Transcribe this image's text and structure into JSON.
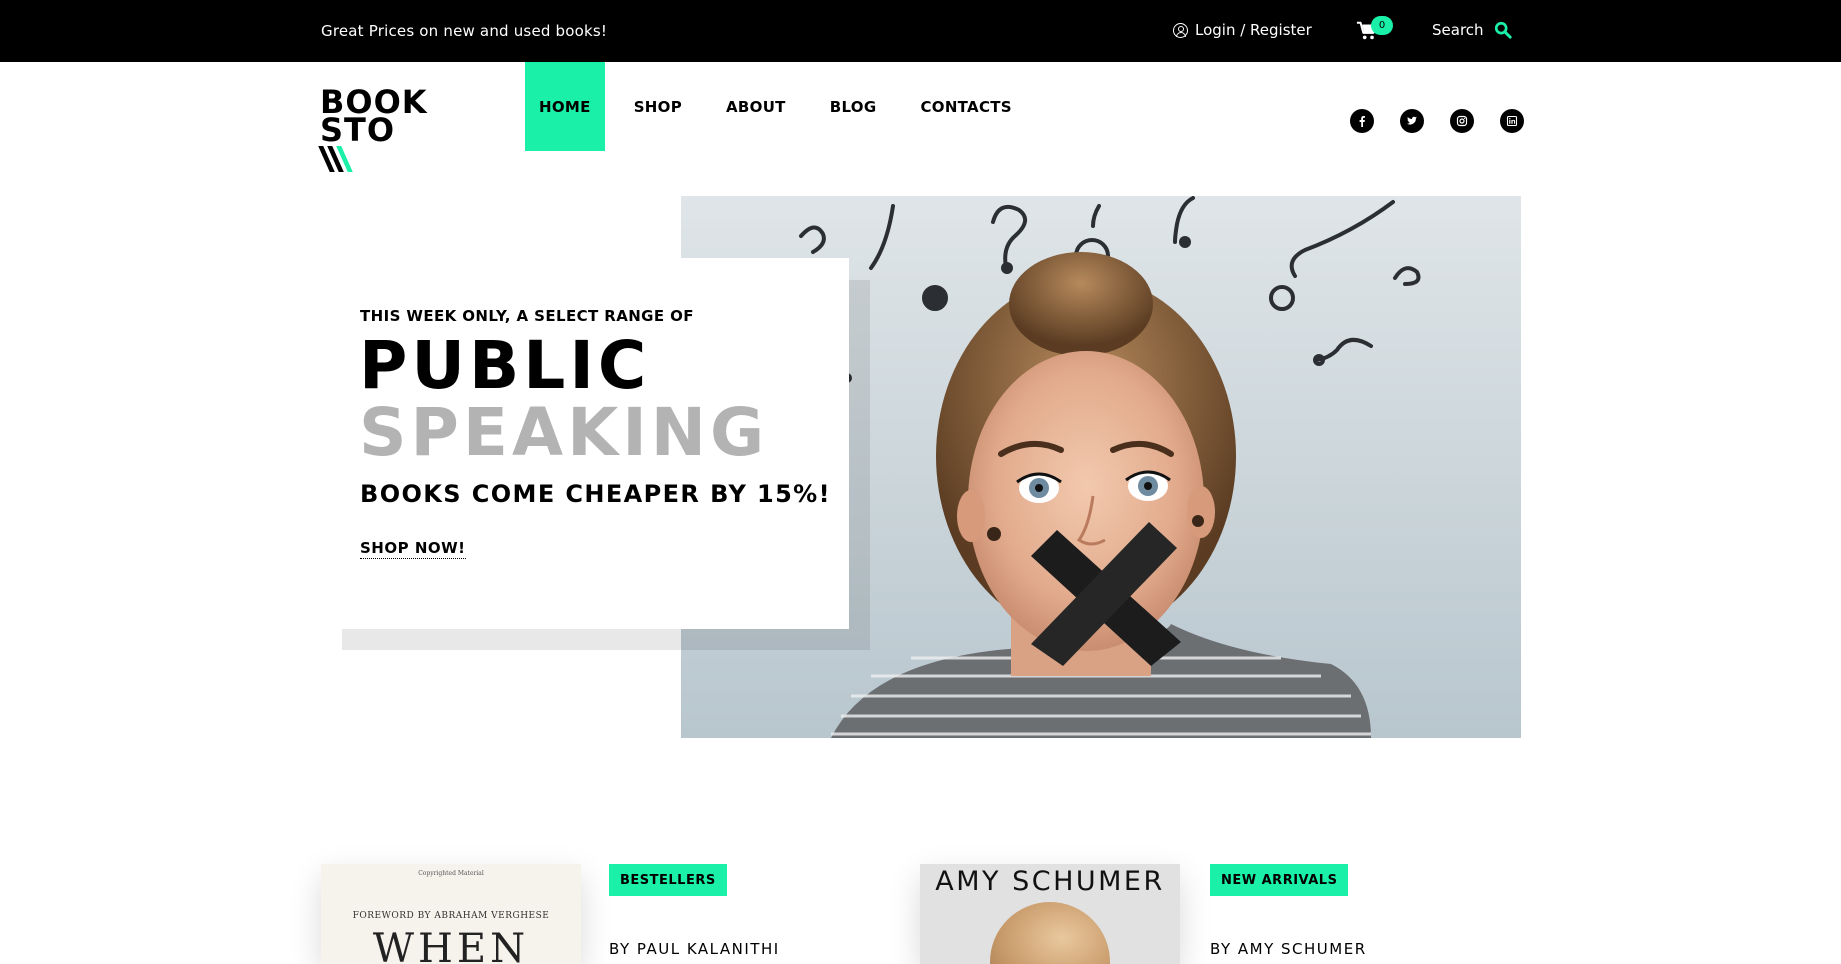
{
  "topbar": {
    "promo": "Great Prices on new and used books!",
    "login": "Login / Register",
    "cart_count": "0",
    "search_label": "Search"
  },
  "logo": {
    "line1": "BOOK",
    "line2": "STO"
  },
  "nav": {
    "items": [
      {
        "label": "HOME",
        "active": true
      },
      {
        "label": "SHOP"
      },
      {
        "label": "ABOUT"
      },
      {
        "label": "BLOG"
      },
      {
        "label": "CONTACTS"
      }
    ]
  },
  "social": [
    "facebook-icon",
    "twitter-icon",
    "instagram-icon",
    "linkedin-icon"
  ],
  "hero": {
    "kicker": "THIS WEEK ONLY, A SELECT RANGE OF",
    "title_line1": "PUBLIC",
    "title_line2": "SPEAKING",
    "subtitle": "BOOKS COME CHEAPER BY 15%!",
    "cta": "SHOP NOW!"
  },
  "featured": [
    {
      "badge": "BESTELLERS",
      "byline": "BY PAUL KALANITHI",
      "cover_small": "Copyrighted Material",
      "cover_foreword": "FOREWORD BY ABRAHAM VERGHESE",
      "cover_title": "WHEN"
    },
    {
      "badge": "NEW ARRIVALS",
      "byline": "BY AMY SCHUMER",
      "cover_author": "AMY SCHUMER"
    }
  ],
  "colors": {
    "accent": "#1af0a8",
    "topbar_bg": "#000000",
    "title_gray": "#b3b3b3"
  }
}
